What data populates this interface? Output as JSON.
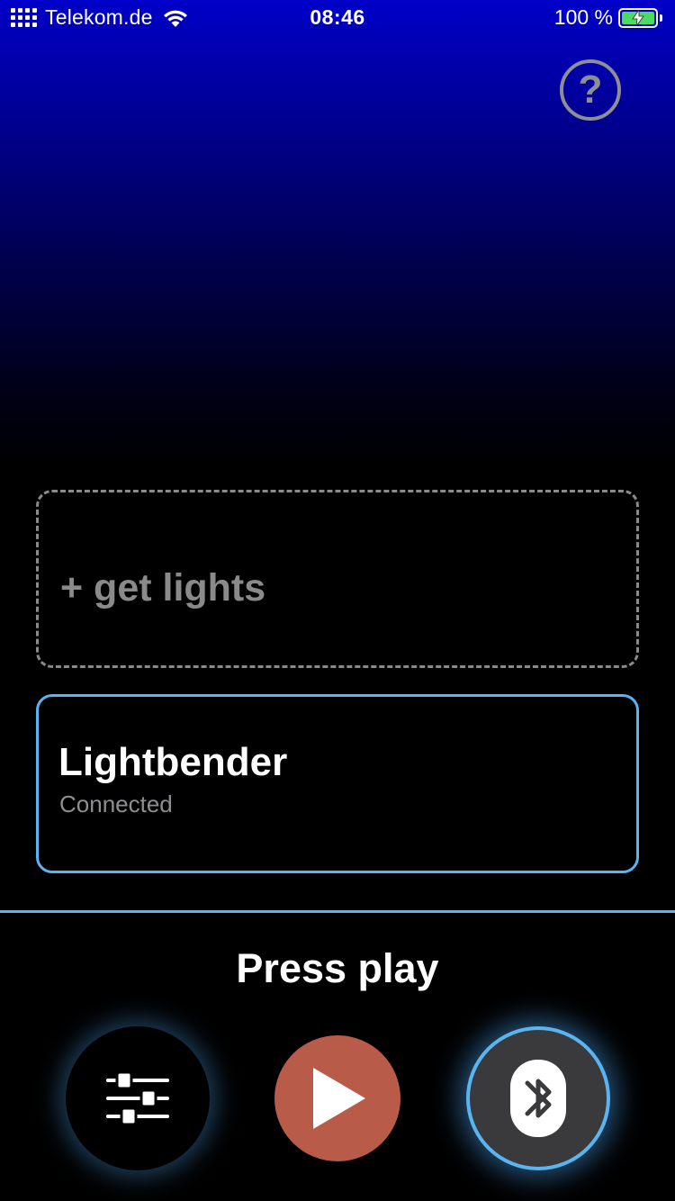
{
  "status_bar": {
    "carrier": "Telekom.de",
    "time": "08:46",
    "battery_percent": "100 %",
    "battery_level": 1.0,
    "battery_color": "#4cd964"
  },
  "help": {
    "icon": "question-mark-icon",
    "label": "?"
  },
  "get_lights": {
    "label": "+ get lights"
  },
  "device": {
    "name": "Lightbender",
    "status": "Connected",
    "accent": "#5ab4f0"
  },
  "footer": {
    "prompt": "Press play",
    "buttons": {
      "settings_icon": "sliders-icon",
      "play_icon": "play-icon",
      "play_color": "#b95b49",
      "bluetooth_icon": "bluetooth-icon"
    }
  }
}
